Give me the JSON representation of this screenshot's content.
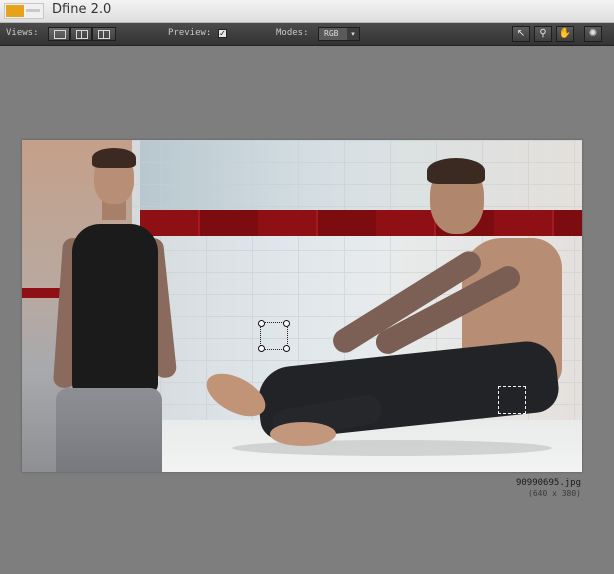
{
  "window": {
    "title": "Dfine 2.0"
  },
  "toolbar": {
    "views_label": "Views:",
    "preview_label": "Preview:",
    "preview_checked": true,
    "modes_label": "Modes:",
    "mode_value": "RGB",
    "tools": [
      {
        "icon": "arrow-pointer-icon"
      },
      {
        "icon": "zoom-icon"
      },
      {
        "icon": "hand-icon"
      },
      {
        "icon": "lightbulb-icon"
      }
    ]
  },
  "image": {
    "file_name": "90990695.jpg",
    "dimensions": "(640 x 380)"
  },
  "colors": {
    "accent": "#e6a21a",
    "canvas": "#808080",
    "toolbar": "#3a3a3a"
  }
}
